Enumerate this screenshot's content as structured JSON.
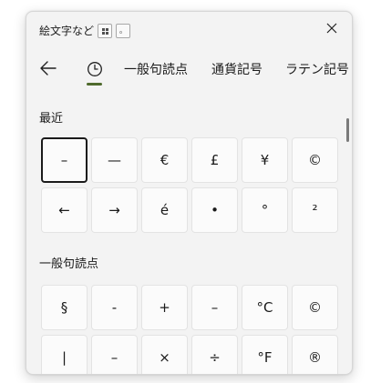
{
  "window": {
    "title": "絵文字など",
    "kaomoji_glyph": "。"
  },
  "tabs": [
    {
      "label": "一般句読点"
    },
    {
      "label": "通貨記号"
    },
    {
      "label": "ラテン記号"
    }
  ],
  "recent": {
    "label": "最近",
    "symbols": [
      "–",
      "—",
      "€",
      "£",
      "¥",
      "©",
      "←",
      "→",
      "é",
      "•",
      "°",
      "²"
    ]
  },
  "general": {
    "label": "一般句読点",
    "symbols": [
      "§",
      "-",
      "+",
      "–",
      "°C",
      "©",
      "|",
      "–",
      "×",
      "÷",
      "°F",
      "®"
    ]
  },
  "colors": {
    "accent": "#4f6a2d",
    "panel_bg": "#f3f3f3",
    "cell_bg": "#fbfbfb"
  },
  "icons": {
    "back": "back-arrow-icon",
    "recent": "clock-icon",
    "close": "close-icon",
    "emoji_grid": "grid-icon"
  }
}
